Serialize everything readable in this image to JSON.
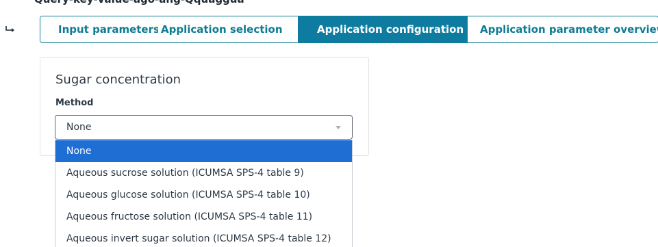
{
  "top_partial_text": "Query-key-value-ago-ang-Qquaggua",
  "tabs": [
    {
      "label": "Input parameters",
      "active": false
    },
    {
      "label": "Application selection",
      "active": false
    },
    {
      "label": "Application configuration",
      "active": true
    },
    {
      "label": "Application parameter overview",
      "active": false
    }
  ],
  "card": {
    "title": "Sugar concentration",
    "method_label": "Method",
    "select_value": "None"
  },
  "dropdown": {
    "options": [
      "None",
      "Aqueous sucrose solution (ICUMSA SPS-4 table 9)",
      "Aqueous glucose solution (ICUMSA SPS-4 table 10)",
      "Aqueous fructose solution (ICUMSA SPS-4 table 11)",
      "Aqueous invert sugar solution (ICUMSA SPS-4 table 12)"
    ],
    "selected_index": 0
  },
  "colors": {
    "accent": "#0e7ca0",
    "tab_text": "#0e7c92",
    "selected_option": "#1f6ed4"
  },
  "icons": {
    "return_arrow": "return-arrow-icon",
    "caret": "chevron-down-icon"
  }
}
